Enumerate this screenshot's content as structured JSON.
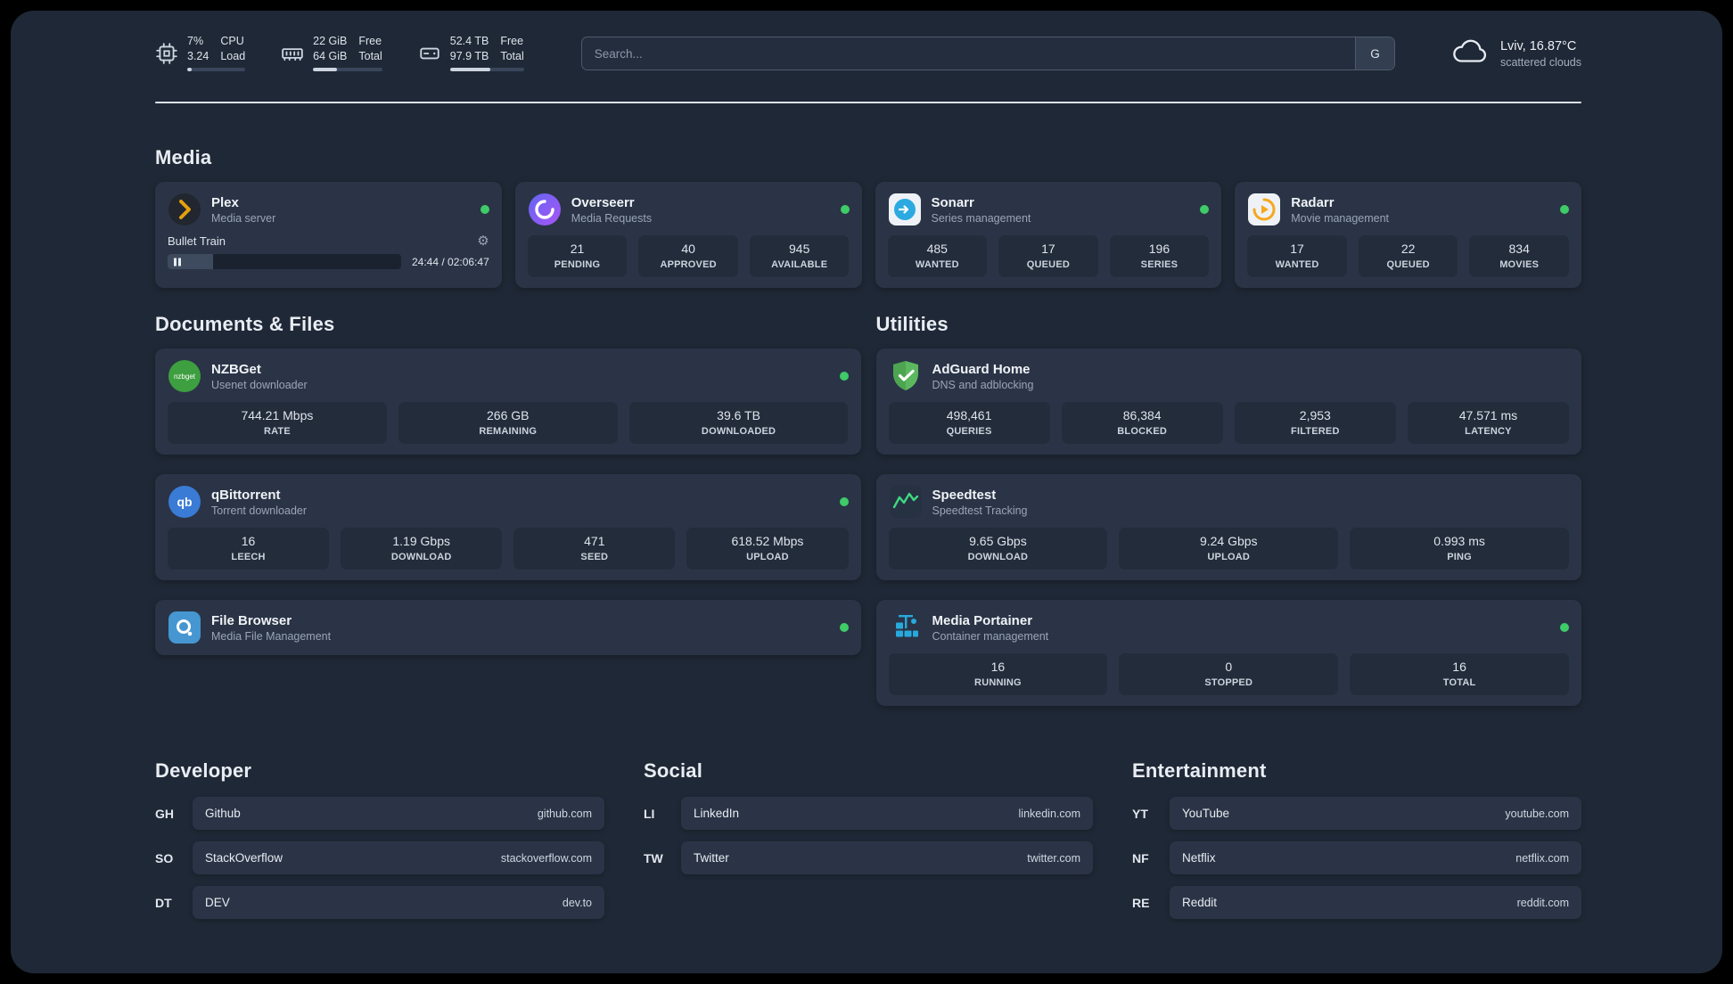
{
  "topbar": {
    "cpu": {
      "value_top": "7%",
      "value_bottom": "3.24",
      "label_top": "CPU",
      "label_bottom": "Load",
      "bar": 7
    },
    "ram": {
      "value_top": "22 GiB",
      "value_bottom": "64 GiB",
      "label_top": "Free",
      "label_bottom": "Total",
      "bar": 34
    },
    "disk": {
      "value_top": "52.4 TB",
      "value_bottom": "97.9 TB",
      "label_top": "Free",
      "label_bottom": "Total",
      "bar": 54
    },
    "search": {
      "placeholder": "Search...",
      "button_label": "G"
    },
    "weather": {
      "location": "Lviv, 16.87°C",
      "condition": "scattered clouds"
    }
  },
  "icons": {
    "gear": "⚙",
    "nzbget_text": "nzbget",
    "qbittorrent_text": "qb"
  },
  "media": {
    "title": "Media",
    "plex": {
      "name": "Plex",
      "subtitle": "Media server",
      "online": true,
      "now_playing": {
        "title": "Bullet Train",
        "time": "24:44 / 02:06:47",
        "progress": 19.5
      }
    },
    "overseerr": {
      "name": "Overseerr",
      "subtitle": "Media Requests",
      "online": true,
      "stats": [
        {
          "value": "21",
          "label": "PENDING"
        },
        {
          "value": "40",
          "label": "APPROVED"
        },
        {
          "value": "945",
          "label": "AVAILABLE"
        }
      ]
    },
    "sonarr": {
      "name": "Sonarr",
      "subtitle": "Series management",
      "online": true,
      "stats": [
        {
          "value": "485",
          "label": "WANTED"
        },
        {
          "value": "17",
          "label": "QUEUED"
        },
        {
          "value": "196",
          "label": "SERIES"
        }
      ]
    },
    "radarr": {
      "name": "Radarr",
      "subtitle": "Movie management",
      "online": true,
      "stats": [
        {
          "value": "17",
          "label": "WANTED"
        },
        {
          "value": "22",
          "label": "QUEUED"
        },
        {
          "value": "834",
          "label": "MOVIES"
        }
      ]
    }
  },
  "documents": {
    "title": "Documents & Files",
    "nzbget": {
      "name": "NZBGet",
      "subtitle": "Usenet downloader",
      "online": true,
      "stats": [
        {
          "value": "744.21 Mbps",
          "label": "RATE"
        },
        {
          "value": "266 GB",
          "label": "REMAINING"
        },
        {
          "value": "39.6 TB",
          "label": "DOWNLOADED"
        }
      ]
    },
    "qbittorrent": {
      "name": "qBittorrent",
      "subtitle": "Torrent downloader",
      "online": true,
      "stats": [
        {
          "value": "16",
          "label": "LEECH"
        },
        {
          "value": "1.19 Gbps",
          "label": "DOWNLOAD"
        },
        {
          "value": "471",
          "label": "SEED"
        },
        {
          "value": "618.52 Mbps",
          "label": "UPLOAD"
        }
      ]
    },
    "filebrowser": {
      "name": "File Browser",
      "subtitle": "Media File Management",
      "online": true
    }
  },
  "utilities": {
    "title": "Utilities",
    "adguard": {
      "name": "AdGuard Home",
      "subtitle": "DNS and adblocking",
      "stats": [
        {
          "value": "498,461",
          "label": "QUERIES"
        },
        {
          "value": "86,384",
          "label": "BLOCKED"
        },
        {
          "value": "2,953",
          "label": "FILTERED"
        },
        {
          "value": "47.571 ms",
          "label": "LATENCY"
        }
      ]
    },
    "speedtest": {
      "name": "Speedtest",
      "subtitle": "Speedtest Tracking",
      "stats": [
        {
          "value": "9.65 Gbps",
          "label": "DOWNLOAD"
        },
        {
          "value": "9.24 Gbps",
          "label": "UPLOAD"
        },
        {
          "value": "0.993 ms",
          "label": "PING"
        }
      ]
    },
    "portainer": {
      "name": "Media Portainer",
      "subtitle": "Container management",
      "online": true,
      "stats": [
        {
          "value": "16",
          "label": "RUNNING"
        },
        {
          "value": "0",
          "label": "STOPPED"
        },
        {
          "value": "16",
          "label": "TOTAL"
        }
      ]
    }
  },
  "bookmarks": {
    "developer": {
      "title": "Developer",
      "items": [
        {
          "abbr": "GH",
          "name": "Github",
          "url": "github.com"
        },
        {
          "abbr": "SO",
          "name": "StackOverflow",
          "url": "stackoverflow.com"
        },
        {
          "abbr": "DT",
          "name": "DEV",
          "url": "dev.to"
        }
      ]
    },
    "social": {
      "title": "Social",
      "items": [
        {
          "abbr": "LI",
          "name": "LinkedIn",
          "url": "linkedin.com"
        },
        {
          "abbr": "TW",
          "name": "Twitter",
          "url": "twitter.com"
        }
      ]
    },
    "entertainment": {
      "title": "Entertainment",
      "items": [
        {
          "abbr": "YT",
          "name": "YouTube",
          "url": "youtube.com"
        },
        {
          "abbr": "NF",
          "name": "Netflix",
          "url": "netflix.com"
        },
        {
          "abbr": "RE",
          "name": "Reddit",
          "url": "reddit.com"
        }
      ]
    }
  }
}
